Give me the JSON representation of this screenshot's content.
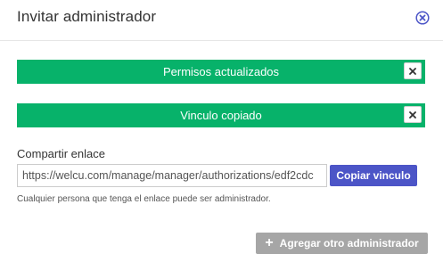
{
  "dialog": {
    "title": "Invitar administrador",
    "close_icon": "close-circle-icon",
    "accent_color": "#4c55c7"
  },
  "alerts": [
    {
      "message": "Permisos actualizados",
      "close_label": "×",
      "color": "#07b26a"
    },
    {
      "message": "Vinculo copiado",
      "close_label": "×",
      "color": "#07b26a"
    }
  ],
  "share": {
    "label": "Compartir enlace",
    "link_value": "https://welcu.com/manage/manager/authorizations/edf2cdc",
    "copy_button_label": "Copiar vinculo",
    "help_text": "Cualquier persona que tenga el enlace puede ser administrador."
  },
  "footer": {
    "add_button_icon": "+",
    "add_button_label": "Agregar otro administrador"
  }
}
